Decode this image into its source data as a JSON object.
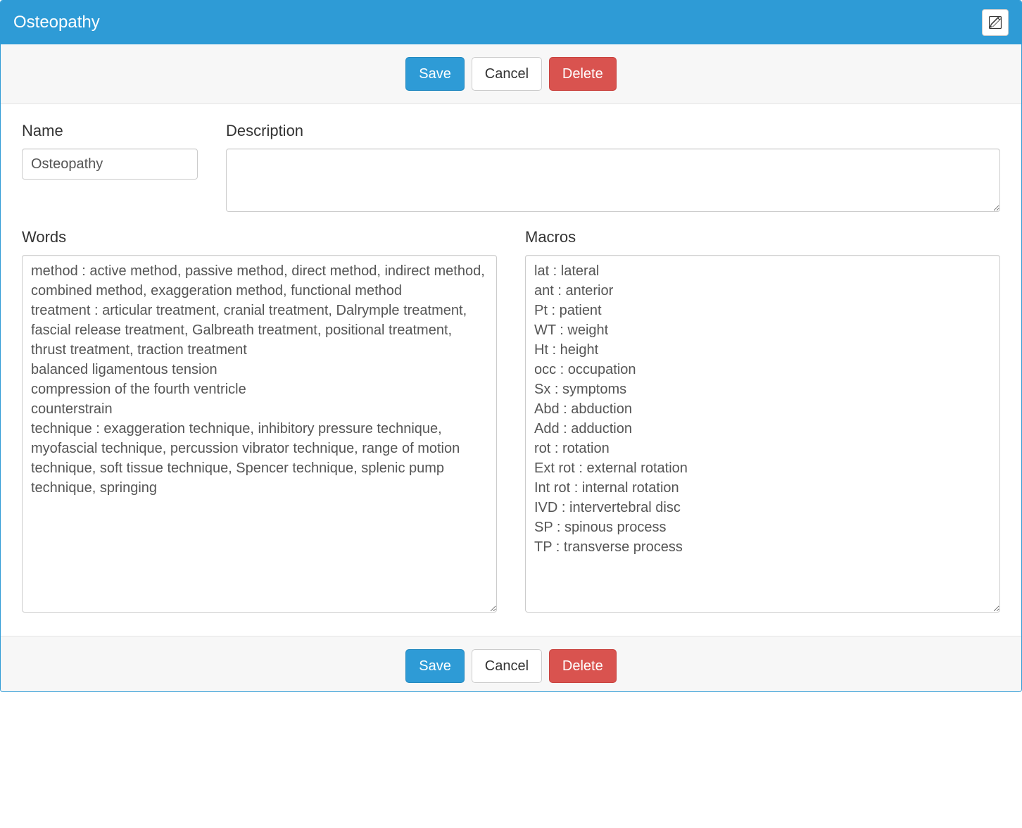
{
  "header": {
    "title": "Osteopathy"
  },
  "toolbar": {
    "save_label": "Save",
    "cancel_label": "Cancel",
    "delete_label": "Delete"
  },
  "form": {
    "name_label": "Name",
    "name_value": "Osteopathy",
    "description_label": "Description",
    "description_value": "",
    "words_label": "Words",
    "words_value": "method : active method, passive method, direct method, indirect method, combined method, exaggeration method, functional method\ntreatment : articular treatment, cranial treatment, Dalrymple treatment, fascial release treatment, Galbreath treatment, positional treatment, thrust treatment, traction treatment\nbalanced ligamentous tension\ncompression of the fourth ventricle\ncounterstrain\ntechnique : exaggeration technique, inhibitory pressure technique, myofascial technique, percussion vibrator technique, range of motion technique, soft tissue technique, Spencer technique, splenic pump technique, springing",
    "macros_label": "Macros",
    "macros_value": "lat : lateral\nant : anterior\nPt : patient\nWT : weight\nHt : height\nocc : occupation\nSx : symptoms\nAbd : abduction\nAdd : adduction\nrot : rotation\nExt rot : external rotation\nInt rot : internal rotation\nIVD : intervertebral disc\nSP : spinous process\nTP : transverse process"
  }
}
